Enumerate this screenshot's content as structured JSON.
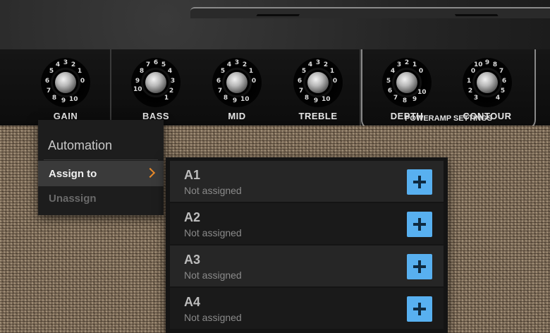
{
  "amp": {
    "knobs": [
      {
        "label": "GAIN"
      },
      {
        "label": "BASS"
      },
      {
        "label": "MID"
      },
      {
        "label": "TREBLE"
      },
      {
        "label": "DEPTH"
      },
      {
        "label": "CONTOUR"
      }
    ],
    "poweramp_label": "POWERAMP SETTINGS"
  },
  "context_menu": {
    "title": "Automation",
    "items": [
      {
        "label": "Assign to"
      },
      {
        "label": "Unassign"
      }
    ]
  },
  "submenu": {
    "items": [
      {
        "name": "A1",
        "status": "Not assigned"
      },
      {
        "name": "A2",
        "status": "Not assigned"
      },
      {
        "name": "A3",
        "status": "Not assigned"
      },
      {
        "name": "A4",
        "status": "Not assigned"
      }
    ]
  },
  "colors": {
    "accent_plus": "#58b0f0",
    "chevron": "#e88a2a"
  }
}
